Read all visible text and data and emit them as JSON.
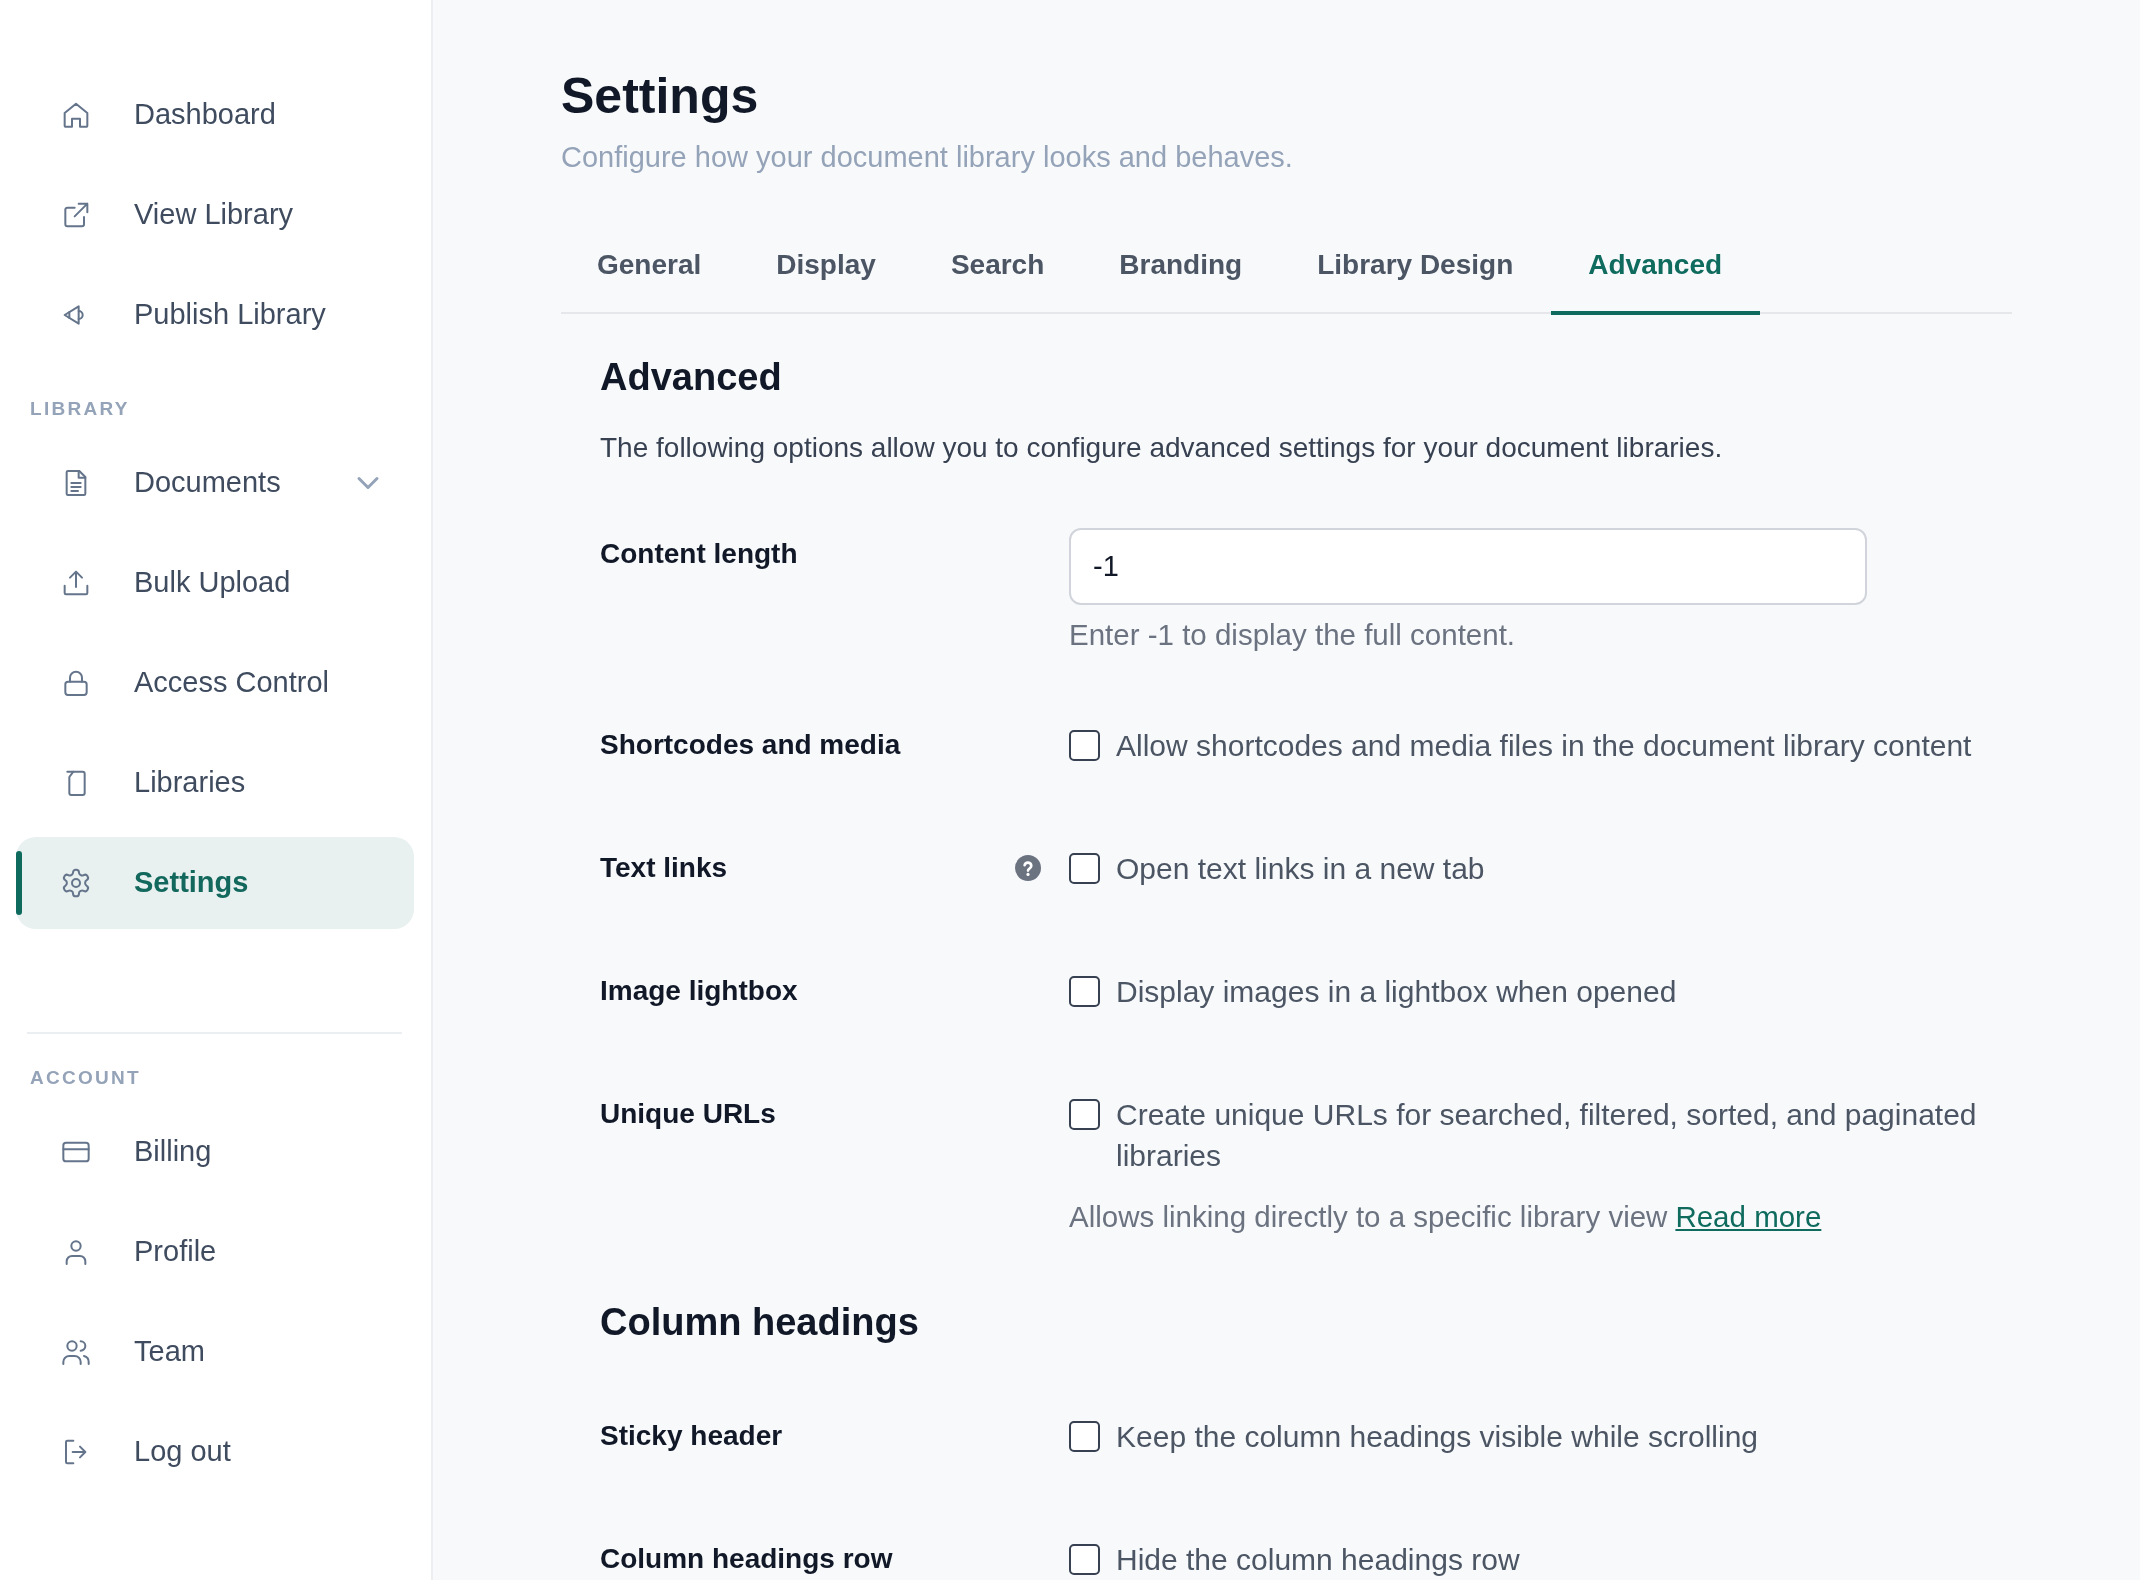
{
  "sidebar": {
    "sections": [
      {
        "items": [
          {
            "label": "Dashboard",
            "kind": "link",
            "selected": false
          },
          {
            "label": "View Library",
            "kind": "link",
            "selected": false
          },
          {
            "label": "Publish Library",
            "kind": "link",
            "selected": false
          }
        ]
      },
      {
        "title": "LIBRARY",
        "items": [
          {
            "label": "Documents",
            "kind": "group",
            "selected": false
          },
          {
            "label": "Bulk Upload",
            "kind": "link",
            "selected": false
          },
          {
            "label": "Access Control",
            "kind": "link",
            "selected": false
          },
          {
            "label": "Libraries",
            "kind": "link",
            "selected": false
          },
          {
            "label": "Settings",
            "kind": "link",
            "selected": true
          }
        ]
      },
      {
        "title": "ACCOUNT",
        "divider": true,
        "items": [
          {
            "label": "Billing",
            "kind": "link",
            "selected": false
          },
          {
            "label": "Profile",
            "kind": "link",
            "selected": false
          },
          {
            "label": "Team",
            "kind": "link",
            "selected": false
          },
          {
            "label": "Log out",
            "kind": "link",
            "selected": false
          }
        ]
      }
    ]
  },
  "header": {
    "title": "Settings",
    "subtitle": "Configure how your document library looks and behaves."
  },
  "tabs": [
    {
      "label": "General",
      "selected": false
    },
    {
      "label": "Display",
      "selected": false
    },
    {
      "label": "Search",
      "selected": false
    },
    {
      "label": "Branding",
      "selected": false
    },
    {
      "label": "Library Design",
      "selected": false
    },
    {
      "label": "Advanced",
      "selected": true
    }
  ],
  "sections": [
    {
      "title": "Advanced",
      "description": "The following options allow you to configure advanced settings for your document libraries.",
      "settings": [
        {
          "kind": "number",
          "label": "Content length",
          "value": "-1",
          "help": "Enter -1 to display the full content."
        },
        {
          "kind": "checkbox",
          "label": "Shortcodes and media",
          "option": "Allow shortcodes and media files in the document library content",
          "checked": false
        },
        {
          "kind": "checkbox",
          "label": "Text links",
          "help_icon": true,
          "option": "Open text links in a new tab",
          "checked": false
        },
        {
          "kind": "checkbox",
          "label": "Image lightbox",
          "option": "Display images in a lightbox when opened",
          "checked": false
        },
        {
          "kind": "checkbox",
          "label": "Unique URLs",
          "option": "Create unique URLs for searched, filtered, sorted, and paginated libraries",
          "checked": false,
          "help": "Allows linking directly to a specific library view",
          "help_link": "Read more"
        }
      ]
    },
    {
      "title": "Column headings",
      "settings": [
        {
          "kind": "checkbox",
          "label": "Sticky header",
          "option": "Keep the column headings visible while scrolling",
          "checked": false
        },
        {
          "kind": "checkbox",
          "label": "Column headings row",
          "option": "Hide the column headings row",
          "checked": false
        }
      ]
    }
  ]
}
